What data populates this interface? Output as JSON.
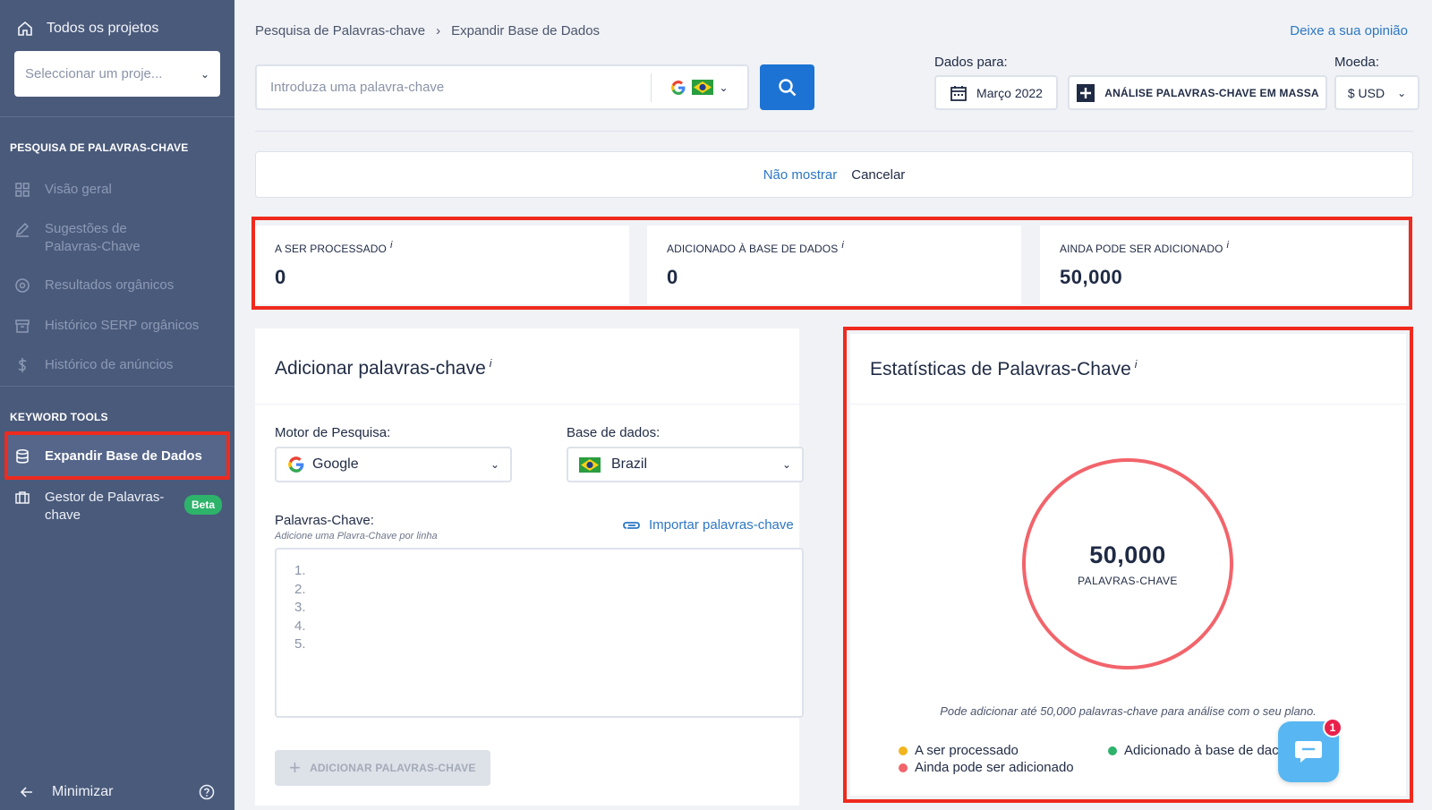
{
  "sidebar": {
    "all_projects": "Todos os projetos",
    "project_placeholder": "Seleccionar um proje...",
    "section1_title": "PESQUISA DE PALAVRAS-CHAVE",
    "section1_items": [
      {
        "label": "Visão geral",
        "icon": "grid-icon"
      },
      {
        "label": "Sugestões de Palavras-Chave",
        "icon": "pencil-icon"
      },
      {
        "label": "Resultados orgânicos",
        "icon": "target-icon"
      },
      {
        "label": "Histórico SERP orgânicos",
        "icon": "archive-icon"
      },
      {
        "label": "Histórico de anúncios",
        "icon": "dollar-icon"
      }
    ],
    "section2_title": "KEYWORD TOOLS",
    "section2_items": [
      {
        "label": "Expandir Base de Dados",
        "icon": "database-icon",
        "active": true
      },
      {
        "label": "Gestor de Palavras-chave",
        "icon": "briefcase-icon",
        "badge": "Beta"
      }
    ],
    "minimize": "Minimizar"
  },
  "header": {
    "breadcrumb": [
      "Pesquisa de Palavras-chave",
      "Expandir Base de Dados"
    ],
    "feedback": "Deixe a sua opinião",
    "search_placeholder": "Introduza uma palavra-chave",
    "data_for_label": "Dados para:",
    "date_value": "Março 2022",
    "bulk_button": "ANÁLISE PALAVRAS-CHAVE EM MASSA",
    "currency_label": "Moeda:",
    "currency_value": "$ USD"
  },
  "notice": {
    "dont_show": "Não mostrar",
    "cancel": "Cancelar"
  },
  "stats": [
    {
      "title": "A SER PROCESSADO",
      "value": "0"
    },
    {
      "title": "ADICIONADO À BASE DE DADOS",
      "value": "0"
    },
    {
      "title": "AINDA PODE SER ADICIONADO",
      "value": "50,000"
    }
  ],
  "add_panel": {
    "title": "Adicionar palavras-chave",
    "engine_label": "Motor de Pesquisa:",
    "engine_value": "Google",
    "db_label": "Base de dados:",
    "db_value": "Brazil",
    "keywords_label": "Palavras-Chave:",
    "keywords_hint": "Adicione uma Plavra-Chave por linha",
    "import_link": "Importar palavras-chave",
    "line_numbers": [
      "1.",
      "2.",
      "3.",
      "4.",
      "5."
    ],
    "add_button": "ADICIONAR PALAVRAS-CHAVE"
  },
  "stats_panel": {
    "title": "Estatísticas de Palavras-Chave",
    "total": "50,000",
    "unit": "PALAVRAS-CHAVE",
    "note": "Pode adicionar até 50,000 palavras-chave para análise com o seu plano.",
    "legend": [
      {
        "label": "A ser processado",
        "color": "#f2b51d"
      },
      {
        "label": "Adicionado à base de dac",
        "color": "#2db36a"
      },
      {
        "label": "Ainda pode ser adicionado",
        "color": "#f2646b"
      }
    ],
    "chat_badge": "1"
  },
  "colors": {
    "accent": "#1d73d4",
    "link": "#2d77c5",
    "highlight": "#ef2a1e",
    "sidebar_bg": "#4a5a7b",
    "donut": "#f2646b"
  }
}
